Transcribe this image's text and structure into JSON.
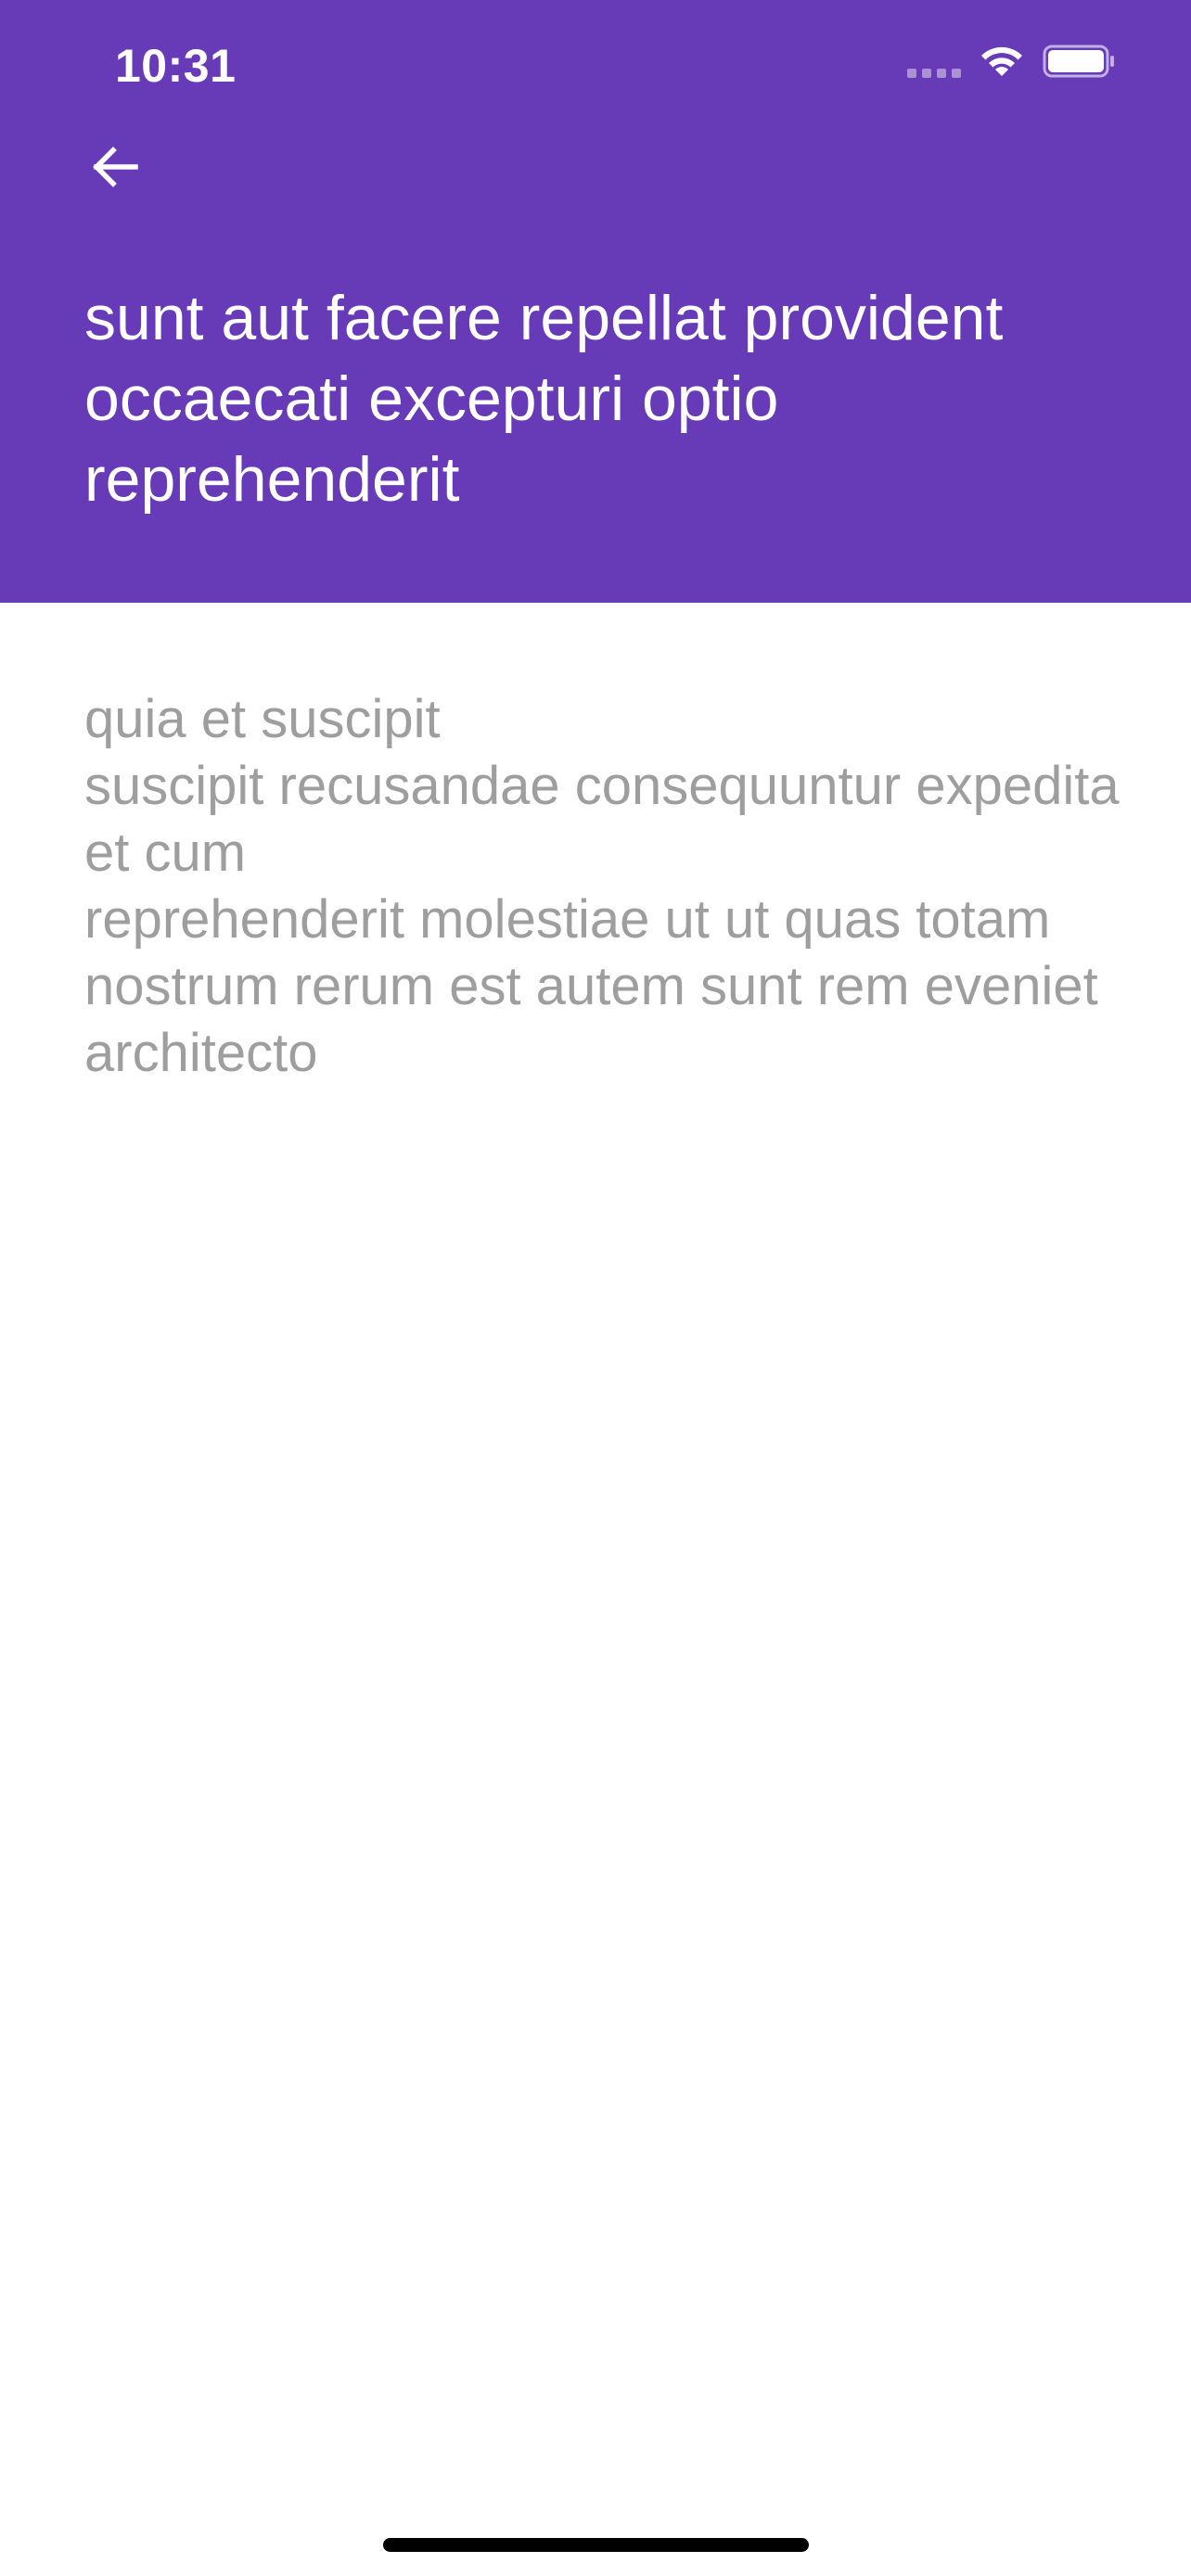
{
  "status_bar": {
    "time": "10:31"
  },
  "header": {
    "background_color": "#673ab7",
    "back_icon": "arrow-left-icon",
    "title": "sunt aut facere repellat provident occaecati excepturi optio reprehenderit"
  },
  "post": {
    "body": "quia et suscipit\nsuscipit recusandae consequuntur expedita et cum\nreprehenderit molestiae ut ut quas totam\nnostrum rerum est autem sunt rem eveniet architecto"
  },
  "colors": {
    "body_text": "#9e9e9e",
    "header_text": "#ffffff"
  }
}
